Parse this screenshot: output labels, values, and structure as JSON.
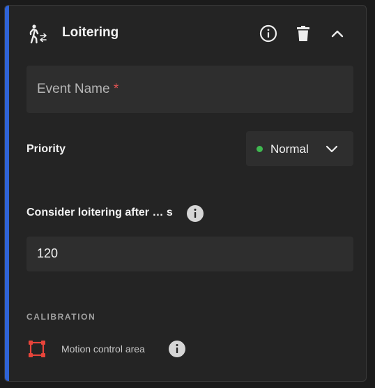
{
  "panel": {
    "title": "Loitering",
    "accent_color": "#2f63d6"
  },
  "event_name": {
    "placeholder": "Event Name",
    "required_marker": "*"
  },
  "priority": {
    "label": "Priority",
    "selected": "Normal",
    "status_color": "#3fb950"
  },
  "loitering": {
    "label": "Consider loitering after … s",
    "value": "120"
  },
  "calibration": {
    "heading": "CALIBRATION",
    "motion_area_label": "Motion control area",
    "motion_area_color": "#e8443a"
  },
  "icons": {
    "header": [
      "walking-person-icon",
      "info-icon",
      "delete-icon",
      "chevron-up-icon"
    ],
    "priority": "chevron-down-icon",
    "loitering": "info-icon",
    "calibration": [
      "polygon-area-icon",
      "info-icon"
    ]
  }
}
